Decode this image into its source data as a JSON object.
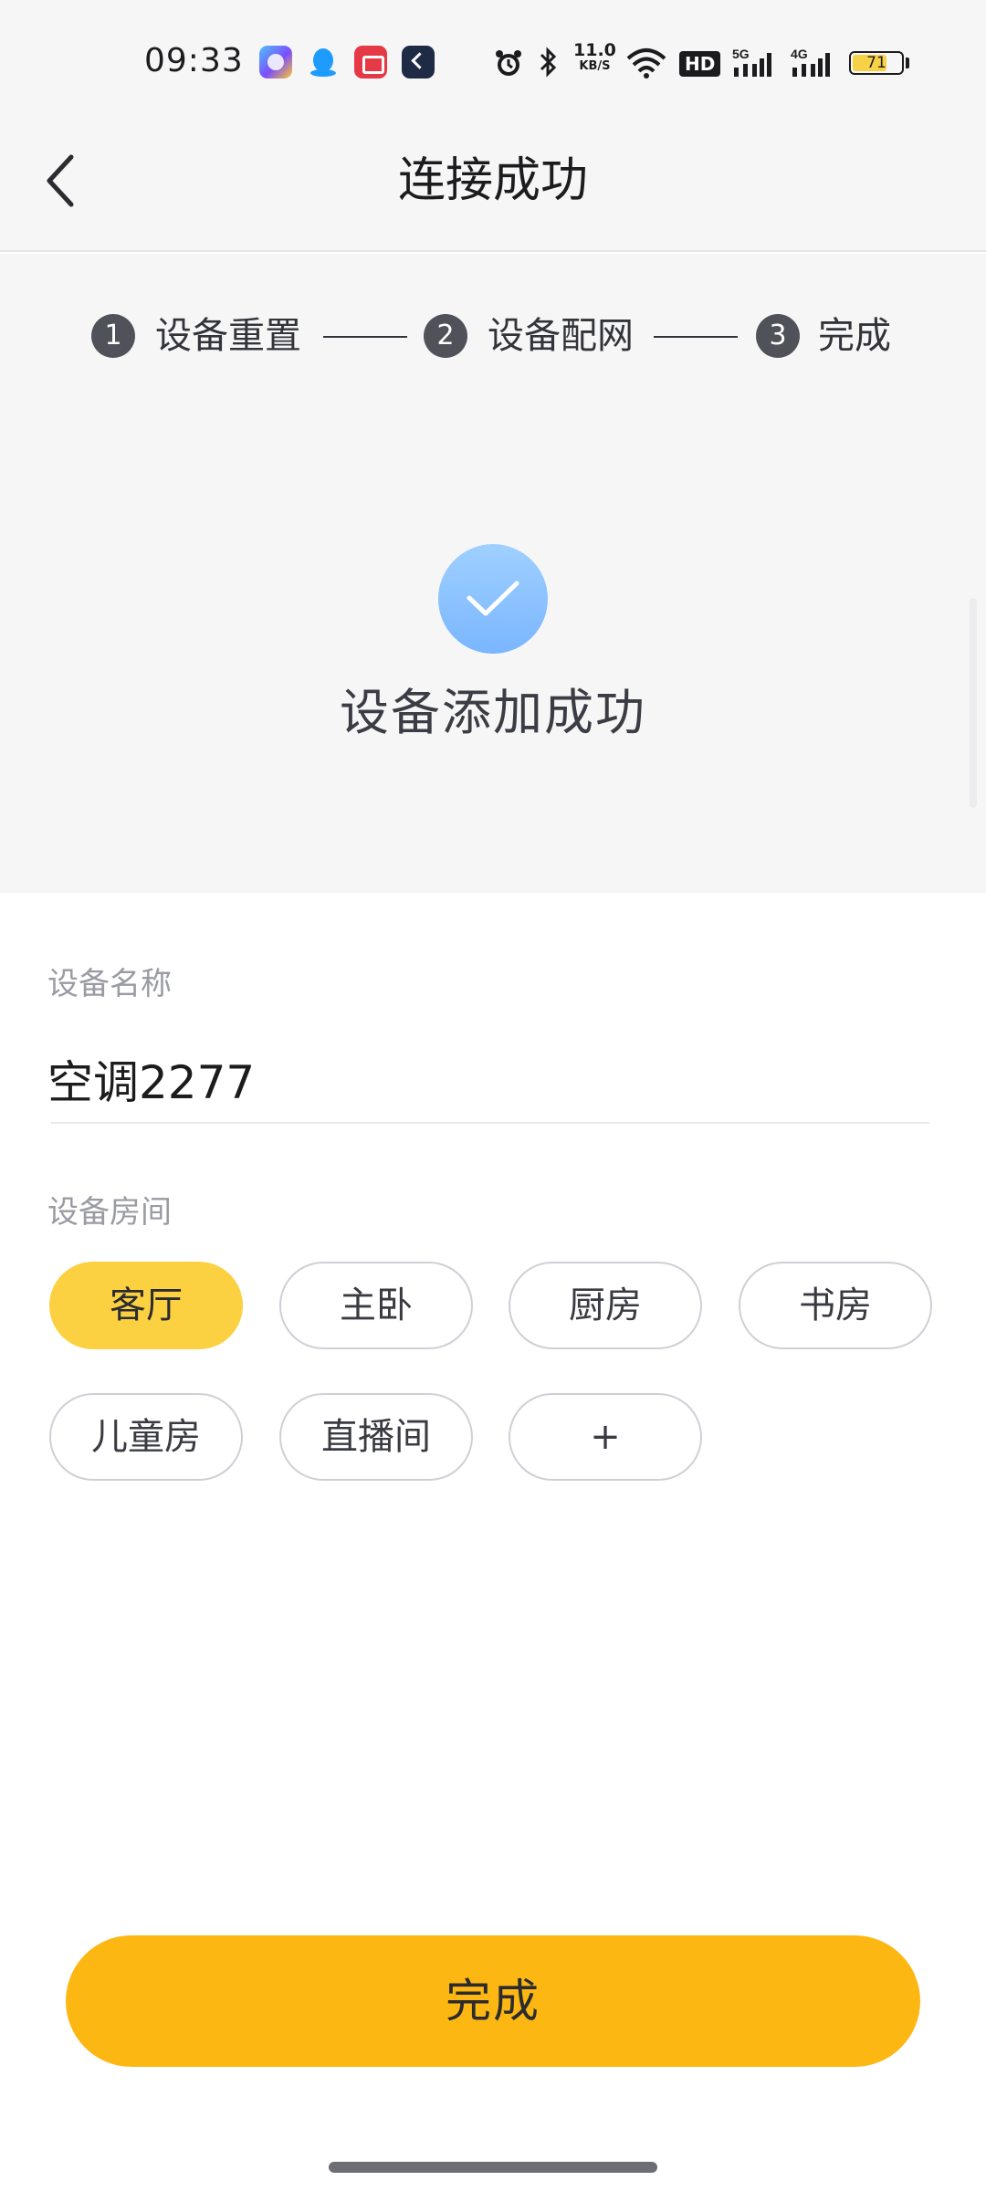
{
  "status_bar": {
    "time": "09:33",
    "network_speed_value": "11.0",
    "network_speed_unit": "KB/S",
    "hd_label": "HD",
    "signal_1": "5G",
    "signal_2": "4G",
    "battery_level": "71",
    "app_icons": [
      "browser-icon",
      "qq-icon",
      "video-app-icon",
      "dark-app-icon"
    ],
    "system_icons": [
      "alarm-icon",
      "bluetooth-icon",
      "wifi-icon",
      "hd-icon",
      "signal-icon",
      "battery-icon"
    ]
  },
  "navbar": {
    "title": "连接成功",
    "back_icon": "chevron-left-icon"
  },
  "steps": [
    {
      "number": "1",
      "label": "设备重置"
    },
    {
      "number": "2",
      "label": "设备配网"
    },
    {
      "number": "3",
      "label": "完成"
    }
  ],
  "success": {
    "icon": "check-icon",
    "message": "设备添加成功",
    "icon_color": "#8ec4ff"
  },
  "form": {
    "name_label": "设备名称",
    "name_value": "空调2277",
    "room_label": "设备房间",
    "rooms": [
      {
        "label": "客厅",
        "selected": true
      },
      {
        "label": "主卧",
        "selected": false
      },
      {
        "label": "厨房",
        "selected": false
      },
      {
        "label": "书房",
        "selected": false
      },
      {
        "label": "儿童房",
        "selected": false
      },
      {
        "label": "直播间",
        "selected": false
      },
      {
        "label": "+",
        "selected": false
      }
    ]
  },
  "footer": {
    "done_label": "完成"
  },
  "colors": {
    "accent_yellow": "#fcb712",
    "chip_selected": "#fcd141",
    "panel_bg": "#f6f6f7"
  }
}
